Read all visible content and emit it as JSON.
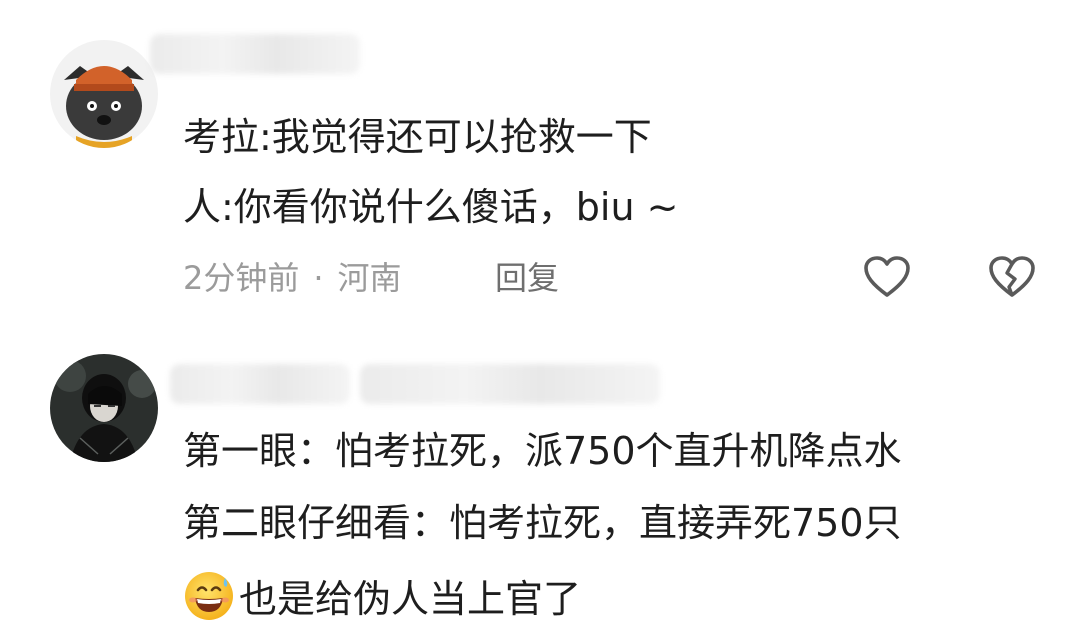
{
  "comments": [
    {
      "lines": [
        "考拉:我觉得还可以抢救一下",
        "人:你看你说什么傻话，biu ~"
      ],
      "time": "2分钟前",
      "separator": "·",
      "location": "河南",
      "reply_label": "回复",
      "avatar_icon": "cartoon-animal-avatar-icon",
      "like_icon": "heart-outline-icon",
      "dislike_icon": "broken-heart-icon"
    },
    {
      "lines": [
        "第一眼：怕考拉死，派750个直升机降点水",
        "第二眼仔细看：怕考拉死，直接弄死750只",
        "也是给伪人当上官了"
      ],
      "avatar_icon": "dark-portrait-avatar-icon",
      "emoji_icon": "grinning-sweat-emoji-icon"
    }
  ],
  "colors": {
    "text": "#1e1e1e",
    "meta": "#9b9b9b",
    "reply": "#6f6f6f",
    "icon": "#5a5a5a"
  }
}
